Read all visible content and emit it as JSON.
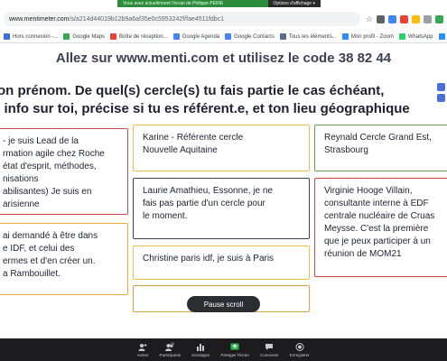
{
  "zoom": {
    "share_label": "Vous avez actuellement l'écran de Philippe PERIE",
    "share_options": "Options d'affichage ▾",
    "toolbar": [
      {
        "icon": "person-invite-icon",
        "label": "Inviter"
      },
      {
        "icon": "participants-icon",
        "label": "Participants",
        "count": "26"
      },
      {
        "icon": "polls-icon",
        "label": "Sondages"
      },
      {
        "icon": "share-screen-icon",
        "label": "Partager l'écran"
      },
      {
        "icon": "chat-icon",
        "label": "Converser"
      },
      {
        "icon": "record-icon",
        "label": "Enregistrer"
      }
    ]
  },
  "browser": {
    "url_domain": "menti.com",
    "url_prefix": "www.mentimeter.com",
    "url_path": "/s/a214d44019b12b9a6af35e0c5953242f/fae4511fdbc1",
    "bookmarks": [
      {
        "label": "Hors connexion -...",
        "color": "#3c6fd8"
      },
      {
        "label": "Google Maps",
        "color": "#34a853"
      },
      {
        "label": "Boîte de réception...",
        "color": "#ea4335"
      },
      {
        "label": "Google Agenda",
        "color": "#4285f4"
      },
      {
        "label": "Google Contacts",
        "color": "#4285f4"
      },
      {
        "label": "Tous les éléments...",
        "color": "#5a6b8c"
      },
      {
        "label": "Mon profil - Zoom",
        "color": "#2d8cff"
      },
      {
        "label": "WhatsApp",
        "color": "#25d366"
      },
      {
        "label": "Accu",
        "color": "#2d8cff"
      }
    ],
    "extension_colors": [
      "#5f6368",
      "#4285f4",
      "#ea4335",
      "#fbbc05",
      "#9aa0a6",
      "#34a853"
    ]
  },
  "menti": {
    "headline_prefix": "Allez sur ",
    "headline_site": "www.menti.com",
    "headline_middle": " et utilisez le code ",
    "headline_code": "38 82 44",
    "question_line1": "ton prénom. De quel(s) cercle(s) tu fais partie le cas échéant,",
    "question_line2": "e info sur toi, précise si tu es référent.e, et ton lieu géographique",
    "pause_label": "Pause scroll",
    "cards": [
      {
        "text": "- je suis Lead de la\nrmation agile chez Roche\nétat d'esprit, méthodes,\nnisations\nabilisantes) Je suis en\narisienne",
        "border": "#c74a4a"
      },
      {
        "text": "ai demandé à être dans\ne IDF, et celui des\nermes et d'en créer un.\na Rambouillet.",
        "border": "#f2a93b"
      },
      {
        "text": "Karine - Référente cercle\nNouvelle Aquitaine",
        "border": "#e8c24a"
      },
      {
        "text": "Laurie Amathieu, Essonne, je ne\nfais pas partie d'un cercle pour\nle moment.",
        "border": "#3d4250"
      },
      {
        "text": "Christine paris idf, je suis à Paris",
        "border": "#e8c24a"
      },
      {
        "text": "",
        "border": "#d9a040"
      },
      {
        "text": "Reynald Cercle Grand Est,\nStrasbourg",
        "border": "#6a9a5a"
      },
      {
        "text": "Virginie Hooge Villain,\nconsultante interne à EDF\ncentrale nucléaire de Cruas\nMeysse. C'est la première\nque je peux participer à un\nréunion de MOM21",
        "border": "#c74a4a"
      }
    ]
  }
}
